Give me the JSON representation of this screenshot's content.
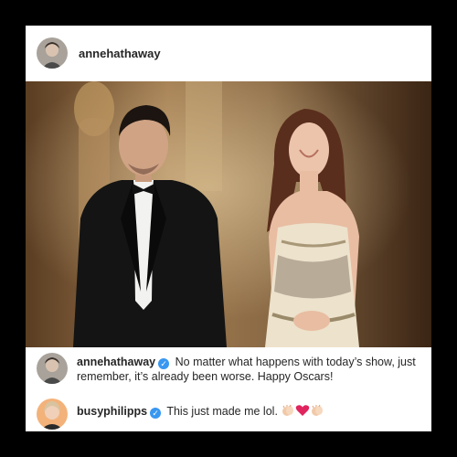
{
  "post": {
    "username": "annehathaway",
    "photo_alt": "Photo"
  },
  "comments": [
    {
      "username": "annehathaway",
      "verified": true,
      "text": "No matter what happens with today’s show, just remember, it’s already been worse. Happy Oscars!"
    },
    {
      "username": "busyphilipps",
      "verified": true,
      "text": "This just made me lol.",
      "emojis": [
        "clapping-hands-icon",
        "red-heart-icon",
        "clapping-hands-icon"
      ]
    }
  ],
  "colors": {
    "background": "#000000",
    "card": "#ffffff",
    "text": "#262626",
    "verified": "#3897f0",
    "heart": "#e0245e"
  }
}
